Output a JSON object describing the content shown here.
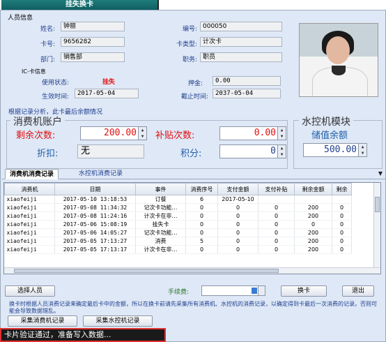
{
  "titlebar": {
    "tab_label": "挂失换卡"
  },
  "person": {
    "section_title": "人员信息",
    "name_label": "姓名:",
    "name_value": "钟丽",
    "id_label": "编号:",
    "id_value": "000050",
    "card_label": "卡号:",
    "card_value": "9656282",
    "cardtype_label": "卡类型:",
    "cardtype_value": "计次卡",
    "dept_label": "部门:",
    "dept_value": "销售部",
    "job_label": "职务:",
    "job_value": "职员"
  },
  "ic": {
    "section_title": "IC-卡信息",
    "status_label": "使用状态:",
    "status_value": "挂失",
    "deposit_label": "押金:",
    "deposit_value": "0.00",
    "start_label": "生效时间:",
    "start_value": "2017-05-04",
    "end_label": "截止时间:",
    "end_value": "2037-05-04"
  },
  "analysis_label": "根据记录分析，此卡最后余额情况",
  "consume_account": {
    "title": "消费机账户",
    "remain_label": "剩余次数:",
    "remain_value": "200.00",
    "subsidy_label": "补贴次数:",
    "subsidy_value": "0.00",
    "discount_label": "折扣:",
    "discount_value": "无",
    "points_label": "积分:",
    "points_value": "0"
  },
  "water_module": {
    "title": "水控机模块",
    "balance_label": "储值余额",
    "balance_value": "500.00"
  },
  "tabs": {
    "active": "消费机消费记录",
    "inactive": "水控机消费记录",
    "menu_arrow": "▼"
  },
  "table": {
    "headers": [
      "消费机",
      "日期",
      "事件",
      "消费序号",
      "支付金额",
      "支付补贴",
      "剩余金额",
      "剩余"
    ],
    "rows": [
      [
        "xiaofeiji",
        "2017-05-10 13:18:53",
        "订餐",
        "6",
        "2017-05-10",
        "",
        "",
        ""
      ],
      [
        "xiaofeiji",
        "2017-05-08 11:34:32",
        "记次卡功能…",
        "0",
        "0",
        "0",
        "200",
        "0"
      ],
      [
        "xiaofeiji",
        "2017-05-08 11:24:16",
        "计次卡在非…",
        "0",
        "0",
        "0",
        "200",
        "0"
      ],
      [
        "xiaofeiji",
        "2017-05-06 15:08:19",
        "挂失卡",
        "0",
        "0",
        "0",
        "0",
        "0"
      ],
      [
        "xiaofeiji",
        "2017-05-06 14:05:27",
        "记次卡功能…",
        "0",
        "0",
        "0",
        "200",
        "0"
      ],
      [
        "xiaofeiji",
        "2017-05-05 17:13:27",
        "消费",
        "5",
        "0",
        "0",
        "200",
        "0"
      ],
      [
        "xiaofeiji",
        "2017-05-05 17:13:17",
        "计次卡在非…",
        "0",
        "0",
        "0",
        "200",
        "0"
      ]
    ]
  },
  "buttons": {
    "select_person": "选择人员",
    "fee_label": "手续费:",
    "change_card": "换卡",
    "exit": "退出",
    "collect_consume": "采集消费机记录",
    "collect_water": "采集水控机记录"
  },
  "notice": "换卡时根据人员消费记录来确定最后卡中的金额，所以在换卡前请先采集所有消费机、水控机的消费记录，以确定得到卡最后一次消费的记录。否则可能会导致数据错乱。",
  "status": "卡片验证通过，准备写入数据...",
  "colors": {
    "accent_red": "#e01010",
    "label_blue": "#1f3f8f",
    "title_teal": "#1f7b7b",
    "status_border": "#e03030"
  }
}
